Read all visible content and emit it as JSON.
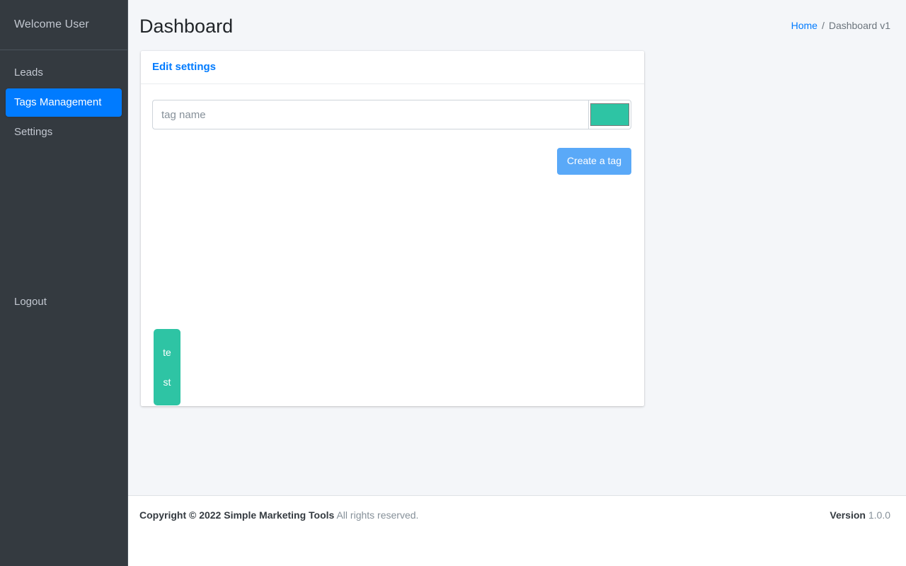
{
  "sidebar": {
    "brand_label": "Welcome User",
    "items": [
      {
        "label": "Leads",
        "active": false
      },
      {
        "label": "Tags Management",
        "active": true
      },
      {
        "label": "Settings",
        "active": false
      }
    ],
    "logout_label": "Logout",
    "active_color": "#007bff",
    "background_color": "#343a40"
  },
  "header": {
    "title": "Dashboard",
    "breadcrumb": {
      "home_label": "Home",
      "separator": "/",
      "current_label": "Dashboard v1"
    }
  },
  "card": {
    "title": "Edit settings",
    "form": {
      "tag_name_placeholder": "tag name",
      "tag_name_value": "",
      "color_value": "#2EC4A4",
      "submit_label": "Create a tag"
    },
    "tags": [
      {
        "label": "test",
        "color": "#2EC4A4"
      }
    ]
  },
  "footer": {
    "copyright_strong": "Copyright © 2022 Simple Marketing Tools",
    "copyright_rest": "All rights reserved.",
    "version_label": "Version",
    "version_number": "1.0.0"
  }
}
